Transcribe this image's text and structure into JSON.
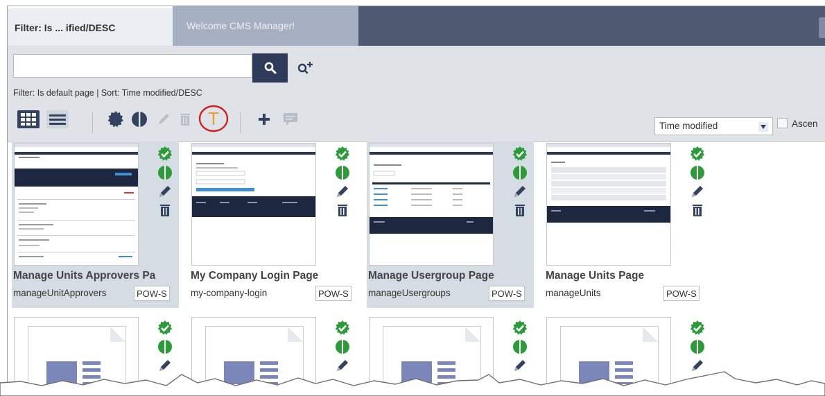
{
  "tabs": [
    {
      "label": "Filter: Is ... ified/DESC"
    },
    {
      "label": "Welcome CMS Manager!"
    }
  ],
  "search": {
    "value": "",
    "placeholder": ""
  },
  "filter_status": "Filter: Is default page | Sort: Time modified/DESC",
  "toolbar": {
    "icons": [
      "grid-view-icon",
      "list-view-icon",
      "default-page-icon",
      "status-icon",
      "edit-icon",
      "trash-icon",
      "template-icon",
      "add-icon",
      "comment-icon"
    ],
    "highlight_color": "#cc1f1f",
    "template_letter": "T"
  },
  "sort": {
    "selected": "Time modified",
    "ascending_label": "Ascen"
  },
  "pages": [
    {
      "title": "Manage Units Approvers Pa",
      "uid": "manageUnitApprovers",
      "catalog": "POW-S"
    },
    {
      "title": "My Company Login Page",
      "uid": "my-company-login",
      "catalog": "POW-S"
    },
    {
      "title": "Manage Usergroup Page",
      "uid": "manageUsergroups",
      "catalog": "POW-S"
    },
    {
      "title": "Manage Units Page",
      "uid": "manageUnits",
      "catalog": "POW-S"
    }
  ],
  "colors": {
    "accent": "#2e3c5a",
    "check": "#2d9b3a",
    "icon": "#33425f",
    "tab_bar": "#4f5a72"
  }
}
